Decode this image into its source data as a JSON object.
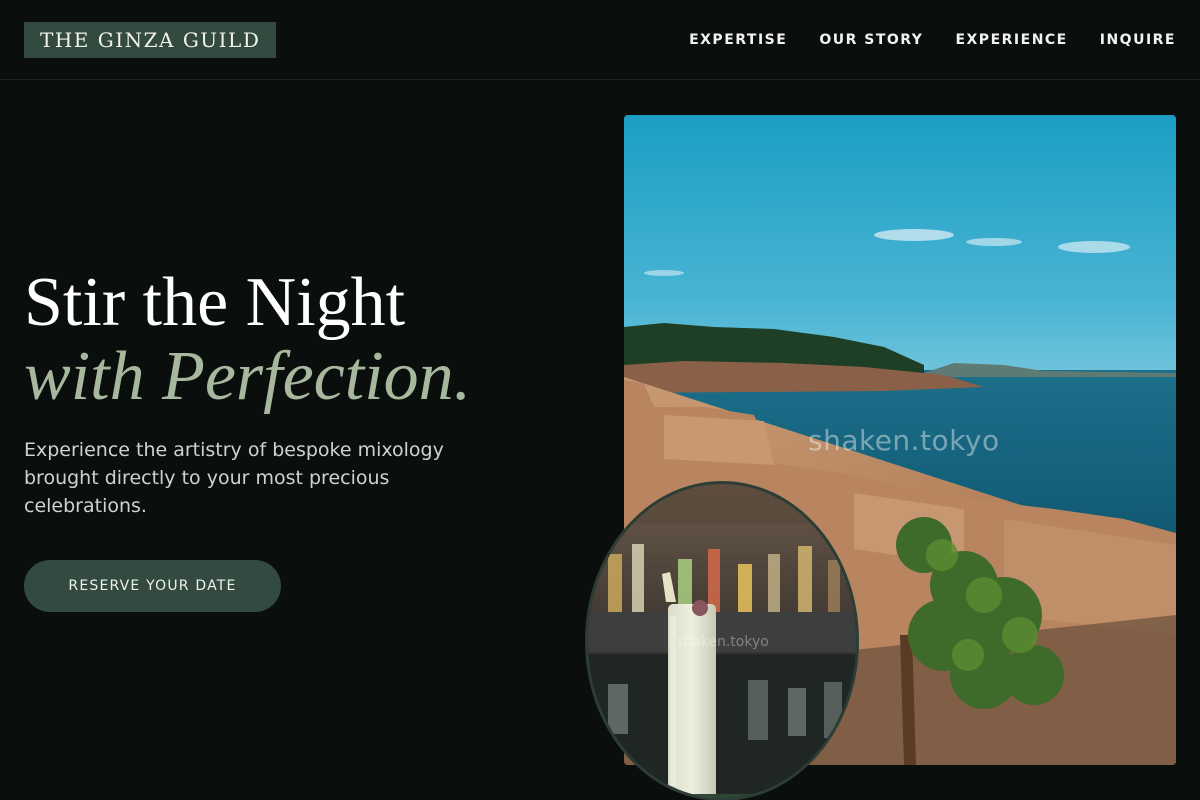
{
  "brand": {
    "name": "THE GINZA GUILD"
  },
  "nav": {
    "items": [
      {
        "label": "EXPERTISE"
      },
      {
        "label": "OUR STORY"
      },
      {
        "label": "EXPERIENCE"
      },
      {
        "label": "INQUIRE"
      }
    ]
  },
  "hero": {
    "title_line1": "Stir the Night",
    "title_line2": "with Perfection.",
    "subtitle": "Experience the artistry of bespoke mixology brought directly to your most precious celebrations.",
    "cta_label": "RESERVE YOUR DATE"
  },
  "images": {
    "main_watermark": "shaken.tokyo",
    "oval_watermark": "shaken.tokyo"
  },
  "colors": {
    "background": "#0a0e0d",
    "accent_green": "#324a40",
    "title_italic": "#a7b89e",
    "text_primary": "#ffffff"
  }
}
